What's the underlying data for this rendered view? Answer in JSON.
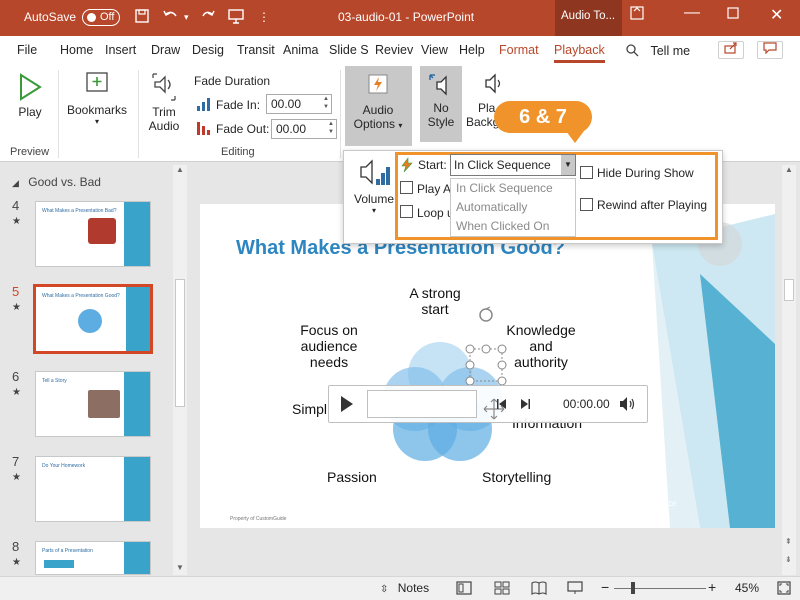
{
  "titlebar": {
    "autosave_label": "AutoSave",
    "toggle_state": "Off",
    "document_title": "03-audio-01  -  PowerPoint",
    "context_tab": "Audio To..."
  },
  "tabs": [
    "File",
    "Home",
    "Insert",
    "Draw",
    "Desig",
    "Transit",
    "Anima",
    "Slide S",
    "Reviev",
    "View",
    "Help",
    "Format",
    "Playback"
  ],
  "tell_me": "Tell me",
  "ribbon": {
    "play_label": "Play",
    "bookmarks_label": "Bookmarks",
    "trim_label_1": "Trim",
    "trim_label_2": "Audio",
    "fade_duration": "Fade Duration",
    "fade_in_label": "Fade In:",
    "fade_in_value": "00.00",
    "fade_out_label": "Fade Out:",
    "fade_out_value": "00.00",
    "audio_options_1": "Audio",
    "audio_options_2": "Options",
    "no_style_1": "No",
    "no_style_2": "Style",
    "play_bg_1": "Pla",
    "play_bg_2": "Backgrou",
    "group_preview": "Preview",
    "group_editing": "Editing"
  },
  "popup": {
    "volume_label": "Volume",
    "start_label": "Start:",
    "start_value": "In Click Sequence",
    "play_across_label": "Play A",
    "loop_label": "Loop u",
    "hide_label": "Hide During Show",
    "rewind_label": "Rewind after Playing",
    "audio_options_group": "Audio Options",
    "dropdown_options": [
      "In Click Sequence",
      "Automatically",
      "When Clicked On"
    ]
  },
  "callout": "6 & 7",
  "slides_pane": {
    "section_name": "Good vs. Bad",
    "thumbs": [
      {
        "num": "4",
        "title": "What Makes a Presentation Bad?"
      },
      {
        "num": "5",
        "title": "What Makes a Presentation Good?"
      },
      {
        "num": "6",
        "title": "Tell a Story"
      },
      {
        "num": "7",
        "title": "Do Your Homework"
      },
      {
        "num": "8",
        "title": "Parts of a Presentation"
      }
    ]
  },
  "slide": {
    "title": "What Makes a Presentation Good?",
    "labels": {
      "strong_start": "A strong start",
      "focus": "Focus on audience needs",
      "knowledge": "Knowledge and authority",
      "simple": "Simpl",
      "information": "Information",
      "passion": "Passion",
      "storytelling": "Storytelling"
    },
    "footer": "Property of CustomGuide",
    "brand": "GUIDE"
  },
  "player": {
    "time": "00:00.00"
  },
  "statusbar": {
    "notes_label": "Notes",
    "zoom": "45%"
  },
  "colors": {
    "accent": "#b7472a",
    "callout": "#f0932b",
    "slide_title": "#2e86c1"
  }
}
